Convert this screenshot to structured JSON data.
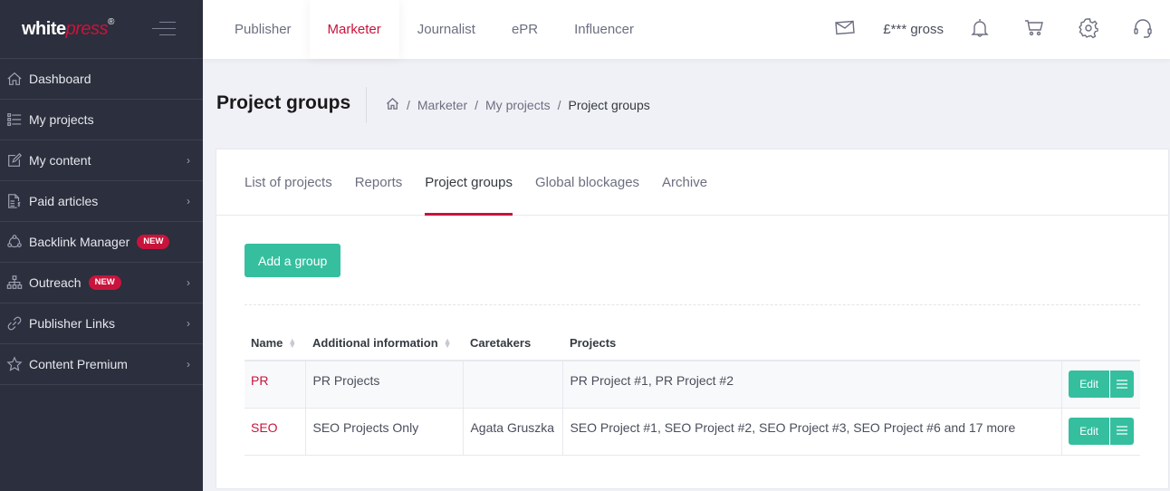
{
  "brand": {
    "name_part1": "white",
    "name_part2": "press",
    "registered": "®",
    "accent_color": "#c8143c",
    "button_color": "#35bf9f",
    "sidebar_color": "#2c2f3d"
  },
  "sidebar": {
    "items": [
      {
        "label": "Dashboard",
        "icon": "home-icon",
        "badge": null,
        "has_submenu": false
      },
      {
        "label": "My projects",
        "icon": "list-icon",
        "badge": null,
        "has_submenu": false
      },
      {
        "label": "My content",
        "icon": "edit-icon",
        "badge": null,
        "has_submenu": true
      },
      {
        "label": "Paid articles",
        "icon": "invoice-icon",
        "badge": null,
        "has_submenu": true
      },
      {
        "label": "Backlink Manager",
        "icon": "network-icon",
        "badge": "NEW",
        "has_submenu": false
      },
      {
        "label": "Outreach",
        "icon": "sitemap-icon",
        "badge": "NEW",
        "has_submenu": true
      },
      {
        "label": "Publisher Links",
        "icon": "link-icon",
        "badge": null,
        "has_submenu": true
      },
      {
        "label": "Content Premium",
        "icon": "star-icon",
        "badge": null,
        "has_submenu": true
      }
    ],
    "chevron": "›"
  },
  "topbar": {
    "roles": [
      {
        "label": "Publisher",
        "active": false
      },
      {
        "label": "Marketer",
        "active": true
      },
      {
        "label": "Journalist",
        "active": false
      },
      {
        "label": "ePR",
        "active": false
      },
      {
        "label": "Influencer",
        "active": false
      }
    ],
    "balance": "£*** gross"
  },
  "page": {
    "title": "Project groups",
    "breadcrumb": [
      "Marketer",
      "My projects",
      "Project groups"
    ],
    "separator": "/"
  },
  "tabs": [
    {
      "label": "List of projects",
      "active": false
    },
    {
      "label": "Reports",
      "active": false
    },
    {
      "label": "Project groups",
      "active": true
    },
    {
      "label": "Global blockages",
      "active": false
    },
    {
      "label": "Archive",
      "active": false
    }
  ],
  "add_button": "Add a group",
  "table": {
    "columns": [
      "Name",
      "Additional information",
      "Caretakers",
      "Projects"
    ],
    "sortable": [
      true,
      true,
      false,
      false
    ],
    "rows": [
      {
        "name": "PR",
        "info": "PR Projects",
        "caretakers": "",
        "projects": "PR Project #1, PR Project #2"
      },
      {
        "name": "SEO",
        "info": "SEO Projects Only",
        "caretakers": "Agata Gruszka",
        "projects": "SEO Project #1, SEO Project #2, SEO Project #3, SEO Project #6 and 17 more"
      }
    ],
    "edit_label": "Edit"
  }
}
